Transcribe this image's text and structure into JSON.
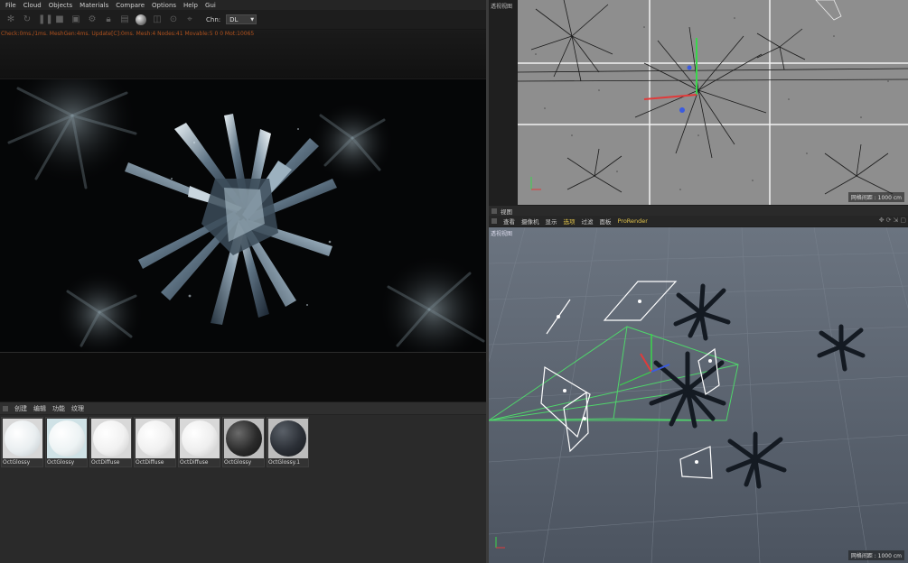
{
  "menubar": {
    "items": [
      "File",
      "Cloud",
      "Objects",
      "Materials",
      "Compare",
      "Options",
      "Help",
      "Gui"
    ]
  },
  "toolbar": {
    "icons": [
      "settings-icon",
      "refresh-icon",
      "pause-icon",
      "stop-icon",
      "save-icon",
      "region-icon",
      "lock-icon",
      "material-sphere-icon",
      "pick-icon",
      "focus-icon",
      "clay-icon"
    ],
    "channel_label": "Chn:",
    "channel_value": "DL"
  },
  "status": {
    "text": "Check:0ms./1ms. MeshGen:4ms. Update[C]:0ms. Mesh:4 Nodes:41 Movable:5  0 0 Mot:10065"
  },
  "material_manager": {
    "tabs": [
      "创建",
      "编辑",
      "功能",
      "纹理"
    ],
    "materials": [
      {
        "name": "OctGlossy",
        "type": "white"
      },
      {
        "name": "OctGlossy",
        "type": "white"
      },
      {
        "name": "OctDiffuse",
        "type": "white"
      },
      {
        "name": "OctDiffuse",
        "type": "white"
      },
      {
        "name": "OctDiffuse",
        "type": "white"
      },
      {
        "name": "OctGlossy",
        "type": "dark-speckle"
      },
      {
        "name": "OctGlossy.1",
        "type": "dark"
      }
    ]
  },
  "viewport_top": {
    "label": "透视视图",
    "grid_info": "网格间距 : 1000 cm"
  },
  "viewport_bottom": {
    "panel_title": "视图",
    "menu": [
      "查看",
      "摄像机",
      "显示",
      "选项",
      "过滤",
      "面板"
    ],
    "prorender": "ProRender",
    "label": "透视视图",
    "grid_info": "网格间距 : 1000 cm"
  },
  "colors": {
    "status_orange": "#b0521e",
    "viewport_top_bg": "#8e8e8e",
    "viewport_bottom_bg": "#5a6370",
    "camera_green": "#4fd66b",
    "axis_x": "#e03b3b",
    "axis_y": "#3ad64c",
    "axis_z": "#3b5be0"
  }
}
